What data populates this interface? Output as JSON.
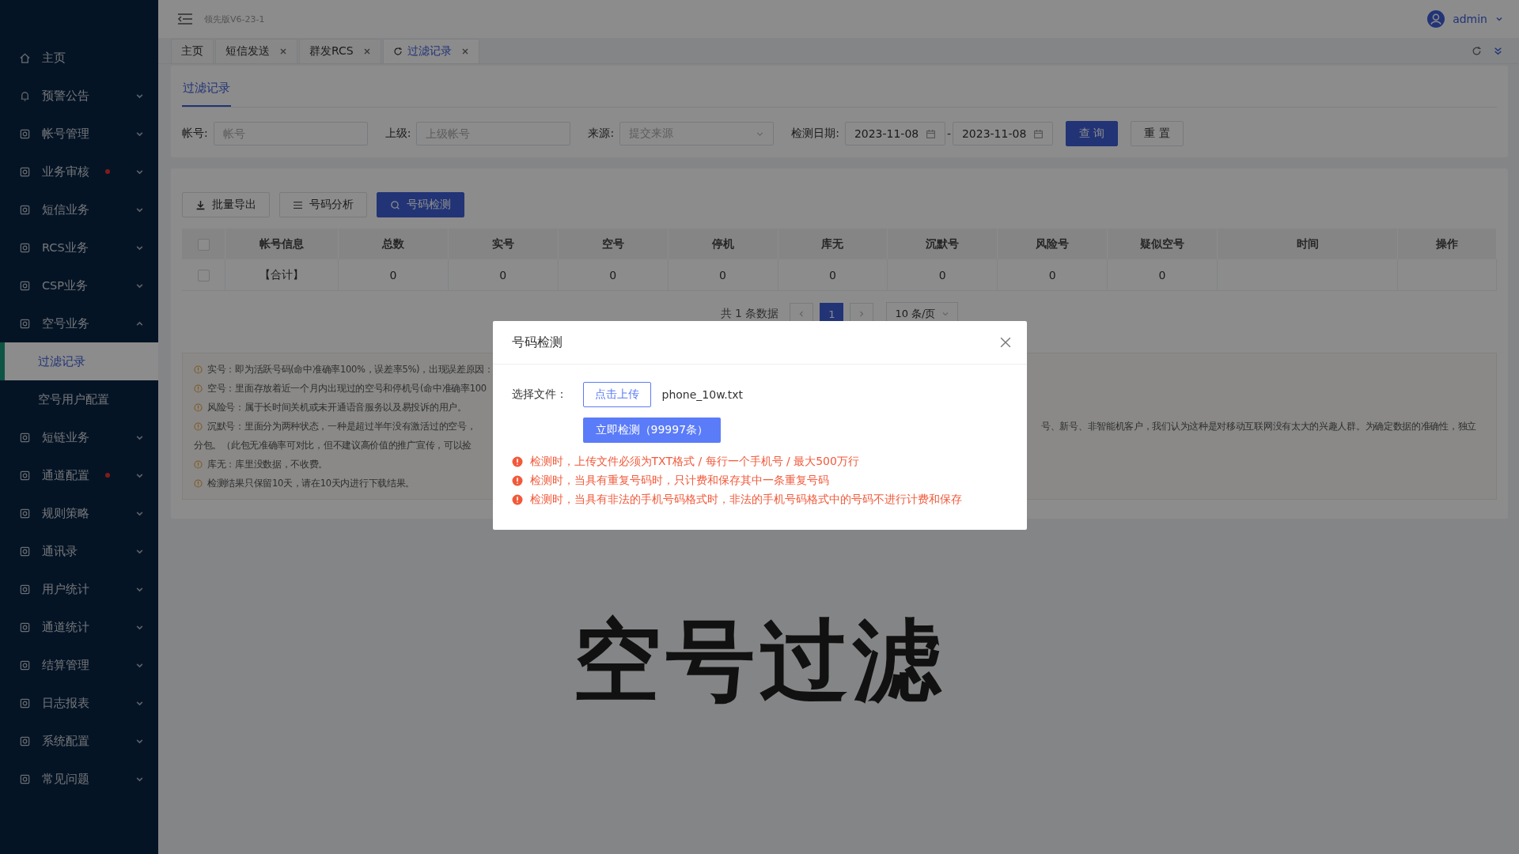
{
  "topbar": {
    "version": "领先版V6-23-1",
    "user": "admin"
  },
  "sidebar": {
    "items": [
      {
        "label": "主页",
        "kind": "link",
        "dot": false
      },
      {
        "label": "预警公告",
        "kind": "group",
        "dot": false,
        "expanded": false
      },
      {
        "label": "帐号管理",
        "kind": "group",
        "dot": false,
        "expanded": false
      },
      {
        "label": "业务审核",
        "kind": "group",
        "dot": true,
        "expanded": false
      },
      {
        "label": "短信业务",
        "kind": "group",
        "dot": false,
        "expanded": false
      },
      {
        "label": "RCS业务",
        "kind": "group",
        "dot": false,
        "expanded": false
      },
      {
        "label": "CSP业务",
        "kind": "group",
        "dot": false,
        "expanded": false
      },
      {
        "label": "空号业务",
        "kind": "group",
        "dot": false,
        "expanded": true,
        "children": [
          {
            "label": "过滤记录",
            "selected": true
          },
          {
            "label": "空号用户配置",
            "selected": false
          }
        ]
      },
      {
        "label": "短链业务",
        "kind": "group",
        "dot": false,
        "expanded": false
      },
      {
        "label": "通道配置",
        "kind": "group",
        "dot": true,
        "expanded": false
      },
      {
        "label": "规则策略",
        "kind": "group",
        "dot": false,
        "expanded": false
      },
      {
        "label": "通讯录",
        "kind": "group",
        "dot": false,
        "expanded": false
      },
      {
        "label": "用户统计",
        "kind": "group",
        "dot": false,
        "expanded": false
      },
      {
        "label": "通道统计",
        "kind": "group",
        "dot": false,
        "expanded": false
      },
      {
        "label": "结算管理",
        "kind": "group",
        "dot": false,
        "expanded": false
      },
      {
        "label": "日志报表",
        "kind": "group",
        "dot": false,
        "expanded": false
      },
      {
        "label": "系统配置",
        "kind": "group",
        "dot": false,
        "expanded": false
      },
      {
        "label": "常见问题",
        "kind": "group",
        "dot": false,
        "expanded": false
      }
    ]
  },
  "tabs": [
    {
      "label": "主页",
      "closable": false,
      "selected": false
    },
    {
      "label": "短信发送",
      "closable": true,
      "selected": false
    },
    {
      "label": "群发RCS",
      "closable": true,
      "selected": false
    },
    {
      "label": "过滤记录",
      "closable": true,
      "selected": true
    }
  ],
  "page_tab": "过滤记录",
  "filters": [
    {
      "kind": "input",
      "label": "帐号:",
      "placeholder": "帐号"
    },
    {
      "kind": "input",
      "label": "上级:",
      "placeholder": "上级帐号"
    },
    {
      "kind": "select",
      "label": "来源:",
      "placeholder": "提交来源"
    },
    {
      "kind": "daterange",
      "label": "检测日期:",
      "start": "2023-11-08",
      "separator": "-",
      "end": "2023-11-08"
    }
  ],
  "filter_buttons": [
    {
      "label": "查 询",
      "primary": true
    },
    {
      "label": "重 置",
      "primary": false
    }
  ],
  "toolbar": [
    {
      "label": "批量导出",
      "primary": false
    },
    {
      "label": "号码分析",
      "primary": false
    },
    {
      "label": "号码检测",
      "primary": true
    }
  ],
  "table": {
    "all_checked": false,
    "columns": [
      "帐号信息",
      "总数",
      "实号",
      "空号",
      "停机",
      "库无",
      "沉默号",
      "风险号",
      "疑似空号",
      "时间",
      "操作"
    ],
    "rows": [
      {
        "checked": false,
        "cells": [
          "【合计】",
          "0",
          "0",
          "0",
          "0",
          "0",
          "0",
          "0",
          "0"
        ]
      }
    ]
  },
  "pagination": {
    "total": "共 1 条数据",
    "pages": [
      {
        "label": "1",
        "selected": true
      }
    ],
    "page_size": "10 条/页"
  },
  "notes": [
    {
      "icon": true,
      "left": "实号：即为活跃号码(命中准确率100%，误差率5%)，出现误差原因："
    },
    {
      "icon": true,
      "left": "空号：里面存放着近一个月内出现过的空号和停机号(命中准确率100"
    },
    {
      "icon": true,
      "left": "风险号：属于长时间关机或未开通语音服务以及易投诉的用户。"
    },
    {
      "icon": true,
      "left": "沉默号：里面分为两种状态，一种是超过半年没有激活过的空号，",
      "right": "号、新号、非智能机客户，我们认为这种是对移动互联网没有太大的兴趣人群。为确定数据的准确性，独立"
    },
    {
      "icon": false,
      "left": "分包。（此包无准确率可对比，但不建议高价值的推广宣传，可以捡"
    },
    {
      "icon": true,
      "left": "库无：库里没数据，不收费。"
    },
    {
      "icon": true,
      "left": "检测结果只保留10天，请在10天内进行下载结果。"
    }
  ],
  "modal": {
    "title": "号码检测",
    "file_label": "选择文件：",
    "upload_button": "点击上传",
    "file_name": "phone_10w.txt",
    "submit_button": "立即检测（99997条）",
    "warnings": [
      "检测时，上传文件必须为TXT格式 / 每行一个手机号 / 最大500万行",
      "检测时，当具有重复号码时，只计费和保存其中一条重复号码",
      "检测时，当具有非法的手机号码格式时，非法的手机号码格式中的号码不进行计费和保存"
    ]
  },
  "caption": "空号过滤"
}
